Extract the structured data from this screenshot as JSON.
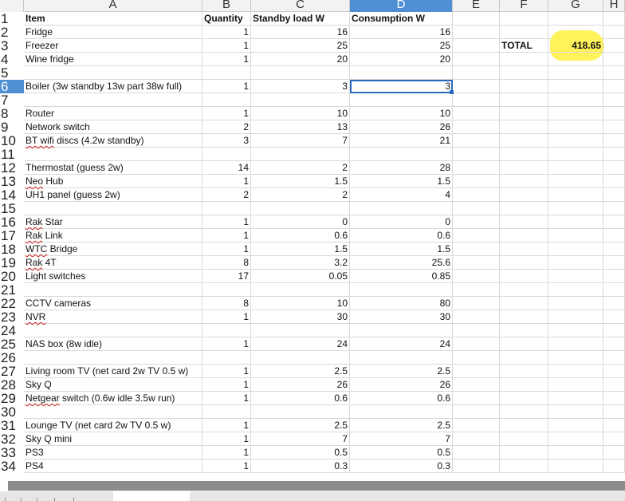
{
  "columns": [
    "A",
    "B",
    "C",
    "D",
    "E",
    "F",
    "G",
    "H"
  ],
  "active_column": "D",
  "active_row": "6",
  "rows": [
    {
      "n": "1",
      "a": "Item",
      "b": "Quantity",
      "c": "Standby load W",
      "d": "Consumption W",
      "header": true
    },
    {
      "n": "2",
      "a": "Fridge",
      "b": "1",
      "c": "16",
      "d": "16"
    },
    {
      "n": "3",
      "a": "Freezer",
      "b": "1",
      "c": "25",
      "d": "25",
      "f": "TOTAL",
      "g": "418.65"
    },
    {
      "n": "4",
      "a": "Wine fridge",
      "b": "1",
      "c": "20",
      "d": "20"
    },
    {
      "n": "5"
    },
    {
      "n": "6",
      "a": "Boiler (3w standby 13w part 38w full)",
      "b": "1",
      "c": "3",
      "d": "3",
      "selected": true
    },
    {
      "n": "7"
    },
    {
      "n": "8",
      "a": "Router",
      "b": "1",
      "c": "10",
      "d": "10"
    },
    {
      "n": "9",
      "a": "Network switch",
      "b": "2",
      "c": "13",
      "d": "26"
    },
    {
      "n": "10",
      "a_sq": "BT wifi",
      "a": " discs (4.2w standby)",
      "b": "3",
      "c": "7",
      "d": "21"
    },
    {
      "n": "11"
    },
    {
      "n": "12",
      "a": "Thermostat (guess 2w)",
      "b": "14",
      "c": "2",
      "d": "28"
    },
    {
      "n": "13",
      "a_sq": "Neo",
      "a": " Hub",
      "b": "1",
      "c": "1.5",
      "d": "1.5"
    },
    {
      "n": "14",
      "a": "UH1 panel (guess 2w)",
      "b": "2",
      "c": "2",
      "d": "4"
    },
    {
      "n": "15"
    },
    {
      "n": "16",
      "a_sq": "Rak",
      "a": " Star",
      "b": "1",
      "c": "0",
      "d": "0"
    },
    {
      "n": "17",
      "a_sq": "Rak",
      "a": " Link",
      "b": "1",
      "c": "0.6",
      "d": "0.6"
    },
    {
      "n": "18",
      "a_sq": "WTC",
      "a": " Bridge",
      "b": "1",
      "c": "1.5",
      "d": "1.5"
    },
    {
      "n": "19",
      "a_sq": "Rak",
      "a": " 4T",
      "b": "8",
      "c": "3.2",
      "d": "25.6"
    },
    {
      "n": "20",
      "a": "Light switches",
      "b": "17",
      "c": "0.05",
      "d": "0.85"
    },
    {
      "n": "21"
    },
    {
      "n": "22",
      "a": "CCTV cameras",
      "b": "8",
      "c": "10",
      "d": "80"
    },
    {
      "n": "23",
      "a_sq": "NVR",
      "a": "",
      "b": "1",
      "c": "30",
      "d": "30"
    },
    {
      "n": "24"
    },
    {
      "n": "25",
      "a": "NAS box (8w idle)",
      "b": "1",
      "c": "24",
      "d": "24"
    },
    {
      "n": "26"
    },
    {
      "n": "27",
      "a": "Living room TV (net card 2w TV 0.5 w)",
      "b": "1",
      "c": "2.5",
      "d": "2.5"
    },
    {
      "n": "28",
      "a": "Sky Q",
      "b": "1",
      "c": "26",
      "d": "26"
    },
    {
      "n": "29",
      "a_sq": "Netgear",
      "a": " switch (0.6w idle 3.5w run)",
      "b": "1",
      "c": "0.6",
      "d": "0.6"
    },
    {
      "n": "30"
    },
    {
      "n": "31",
      "a": "Lounge TV (net card 2w TV 0.5 w)",
      "b": "1",
      "c": "2.5",
      "d": "2.5"
    },
    {
      "n": "32",
      "a": "Sky Q mini",
      "b": "1",
      "c": "7",
      "d": "7"
    },
    {
      "n": "33",
      "a": "PS3",
      "b": "1",
      "c": "0.5",
      "d": "0.5"
    },
    {
      "n": "34",
      "a": "PS4",
      "b": "1",
      "c": "0.3",
      "d": "0.3"
    }
  ],
  "colors": {
    "selection": "#4f8fd3",
    "highlight": "#fff25a",
    "grid": "#d9d9d9"
  }
}
